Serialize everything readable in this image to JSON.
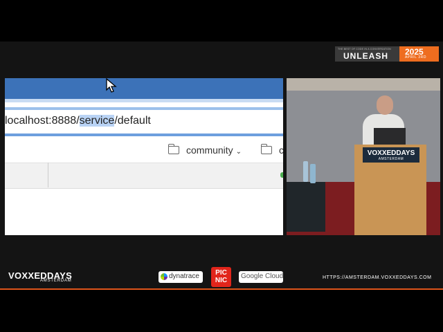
{
  "event_badge": {
    "tagline": "THE BEST OF CODE IN A CONVERSATION",
    "name": "UNLEASH",
    "year": "2025",
    "date": "APRIL 3RD"
  },
  "browser": {
    "url_prefix": "localhost:8888/",
    "url_highlight": "service",
    "url_suffix": "/default",
    "bookmarks": [
      {
        "label": "community"
      },
      {
        "label": "c"
      }
    ]
  },
  "podium": {
    "brand": "VOXXEDDAYS",
    "city": "AMSTERDAM"
  },
  "footer": {
    "logo_text": "VOXXEDDAYS",
    "logo_city": "AMSTERDAM",
    "sponsors": [
      {
        "name": "dynatrace"
      },
      {
        "name": "PIC NIC"
      },
      {
        "name": "Google Cloud"
      }
    ],
    "website": "HTTPS://AMSTERDAM.VOXXEDDAYS.COM"
  }
}
